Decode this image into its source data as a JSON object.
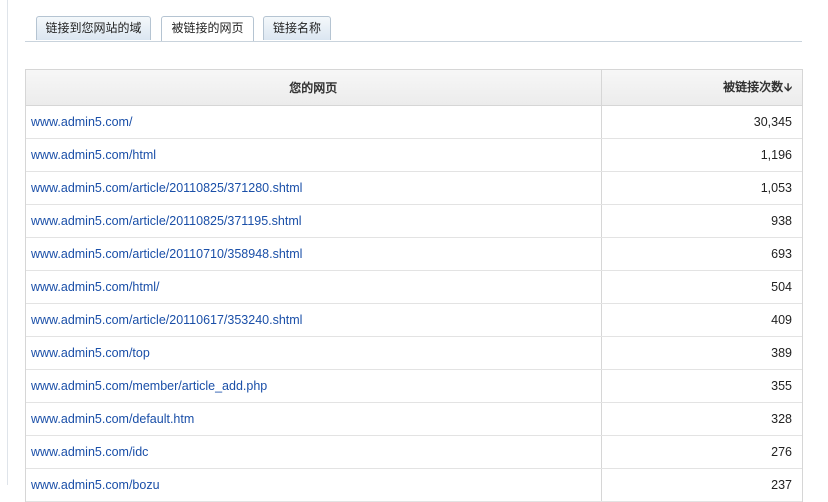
{
  "tabs": [
    {
      "label": "链接到您网站的域",
      "active": false
    },
    {
      "label": "被链接的网页",
      "active": true
    },
    {
      "label": "链接名称",
      "active": false
    }
  ],
  "table": {
    "headers": {
      "page": "您的网页",
      "count": "被链接次数",
      "sort_icon": "arrow-down-icon"
    },
    "rows": [
      {
        "url": "www.admin5.com/",
        "count": "30,345"
      },
      {
        "url": "www.admin5.com/html",
        "count": "1,196"
      },
      {
        "url": "www.admin5.com/article/20110825/371280.shtml",
        "count": "1,053"
      },
      {
        "url": "www.admin5.com/article/20110825/371195.shtml",
        "count": "938"
      },
      {
        "url": "www.admin5.com/article/20110710/358948.shtml",
        "count": "693"
      },
      {
        "url": "www.admin5.com/html/",
        "count": "504"
      },
      {
        "url": "www.admin5.com/article/20110617/353240.shtml",
        "count": "409"
      },
      {
        "url": "www.admin5.com/top",
        "count": "389"
      },
      {
        "url": "www.admin5.com/member/article_add.php",
        "count": "355"
      },
      {
        "url": "www.admin5.com/default.htm",
        "count": "328"
      },
      {
        "url": "www.admin5.com/idc",
        "count": "276"
      },
      {
        "url": "www.admin5.com/bozu",
        "count": "237"
      }
    ]
  },
  "colors": {
    "link": "#1a4fa8",
    "tab_border": "#b5c4d2"
  }
}
